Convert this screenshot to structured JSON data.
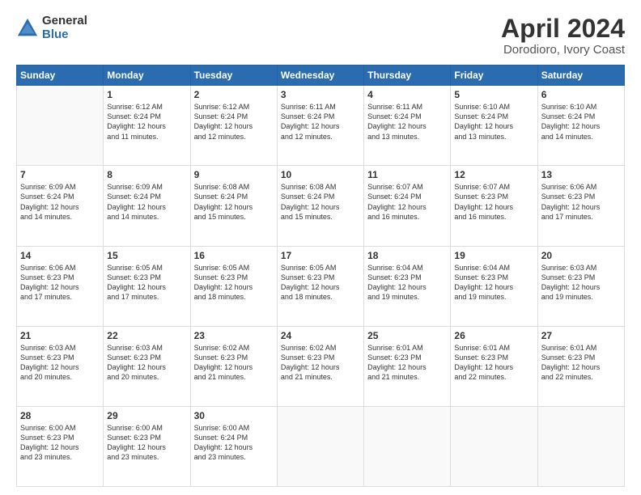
{
  "logo": {
    "general": "General",
    "blue": "Blue"
  },
  "title": "April 2024",
  "subtitle": "Dorodioro, Ivory Coast",
  "days_of_week": [
    "Sunday",
    "Monday",
    "Tuesday",
    "Wednesday",
    "Thursday",
    "Friday",
    "Saturday"
  ],
  "weeks": [
    [
      {
        "day": "",
        "info": ""
      },
      {
        "day": "1",
        "info": "Sunrise: 6:12 AM\nSunset: 6:24 PM\nDaylight: 12 hours\nand 11 minutes."
      },
      {
        "day": "2",
        "info": "Sunrise: 6:12 AM\nSunset: 6:24 PM\nDaylight: 12 hours\nand 12 minutes."
      },
      {
        "day": "3",
        "info": "Sunrise: 6:11 AM\nSunset: 6:24 PM\nDaylight: 12 hours\nand 12 minutes."
      },
      {
        "day": "4",
        "info": "Sunrise: 6:11 AM\nSunset: 6:24 PM\nDaylight: 12 hours\nand 13 minutes."
      },
      {
        "day": "5",
        "info": "Sunrise: 6:10 AM\nSunset: 6:24 PM\nDaylight: 12 hours\nand 13 minutes."
      },
      {
        "day": "6",
        "info": "Sunrise: 6:10 AM\nSunset: 6:24 PM\nDaylight: 12 hours\nand 14 minutes."
      }
    ],
    [
      {
        "day": "7",
        "info": "Sunrise: 6:09 AM\nSunset: 6:24 PM\nDaylight: 12 hours\nand 14 minutes."
      },
      {
        "day": "8",
        "info": "Sunrise: 6:09 AM\nSunset: 6:24 PM\nDaylight: 12 hours\nand 14 minutes."
      },
      {
        "day": "9",
        "info": "Sunrise: 6:08 AM\nSunset: 6:24 PM\nDaylight: 12 hours\nand 15 minutes."
      },
      {
        "day": "10",
        "info": "Sunrise: 6:08 AM\nSunset: 6:24 PM\nDaylight: 12 hours\nand 15 minutes."
      },
      {
        "day": "11",
        "info": "Sunrise: 6:07 AM\nSunset: 6:24 PM\nDaylight: 12 hours\nand 16 minutes."
      },
      {
        "day": "12",
        "info": "Sunrise: 6:07 AM\nSunset: 6:23 PM\nDaylight: 12 hours\nand 16 minutes."
      },
      {
        "day": "13",
        "info": "Sunrise: 6:06 AM\nSunset: 6:23 PM\nDaylight: 12 hours\nand 17 minutes."
      }
    ],
    [
      {
        "day": "14",
        "info": "Sunrise: 6:06 AM\nSunset: 6:23 PM\nDaylight: 12 hours\nand 17 minutes."
      },
      {
        "day": "15",
        "info": "Sunrise: 6:05 AM\nSunset: 6:23 PM\nDaylight: 12 hours\nand 17 minutes."
      },
      {
        "day": "16",
        "info": "Sunrise: 6:05 AM\nSunset: 6:23 PM\nDaylight: 12 hours\nand 18 minutes."
      },
      {
        "day": "17",
        "info": "Sunrise: 6:05 AM\nSunset: 6:23 PM\nDaylight: 12 hours\nand 18 minutes."
      },
      {
        "day": "18",
        "info": "Sunrise: 6:04 AM\nSunset: 6:23 PM\nDaylight: 12 hours\nand 19 minutes."
      },
      {
        "day": "19",
        "info": "Sunrise: 6:04 AM\nSunset: 6:23 PM\nDaylight: 12 hours\nand 19 minutes."
      },
      {
        "day": "20",
        "info": "Sunrise: 6:03 AM\nSunset: 6:23 PM\nDaylight: 12 hours\nand 19 minutes."
      }
    ],
    [
      {
        "day": "21",
        "info": "Sunrise: 6:03 AM\nSunset: 6:23 PM\nDaylight: 12 hours\nand 20 minutes."
      },
      {
        "day": "22",
        "info": "Sunrise: 6:03 AM\nSunset: 6:23 PM\nDaylight: 12 hours\nand 20 minutes."
      },
      {
        "day": "23",
        "info": "Sunrise: 6:02 AM\nSunset: 6:23 PM\nDaylight: 12 hours\nand 21 minutes."
      },
      {
        "day": "24",
        "info": "Sunrise: 6:02 AM\nSunset: 6:23 PM\nDaylight: 12 hours\nand 21 minutes."
      },
      {
        "day": "25",
        "info": "Sunrise: 6:01 AM\nSunset: 6:23 PM\nDaylight: 12 hours\nand 21 minutes."
      },
      {
        "day": "26",
        "info": "Sunrise: 6:01 AM\nSunset: 6:23 PM\nDaylight: 12 hours\nand 22 minutes."
      },
      {
        "day": "27",
        "info": "Sunrise: 6:01 AM\nSunset: 6:23 PM\nDaylight: 12 hours\nand 22 minutes."
      }
    ],
    [
      {
        "day": "28",
        "info": "Sunrise: 6:00 AM\nSunset: 6:23 PM\nDaylight: 12 hours\nand 23 minutes."
      },
      {
        "day": "29",
        "info": "Sunrise: 6:00 AM\nSunset: 6:23 PM\nDaylight: 12 hours\nand 23 minutes."
      },
      {
        "day": "30",
        "info": "Sunrise: 6:00 AM\nSunset: 6:24 PM\nDaylight: 12 hours\nand 23 minutes."
      },
      {
        "day": "",
        "info": ""
      },
      {
        "day": "",
        "info": ""
      },
      {
        "day": "",
        "info": ""
      },
      {
        "day": "",
        "info": ""
      }
    ]
  ]
}
